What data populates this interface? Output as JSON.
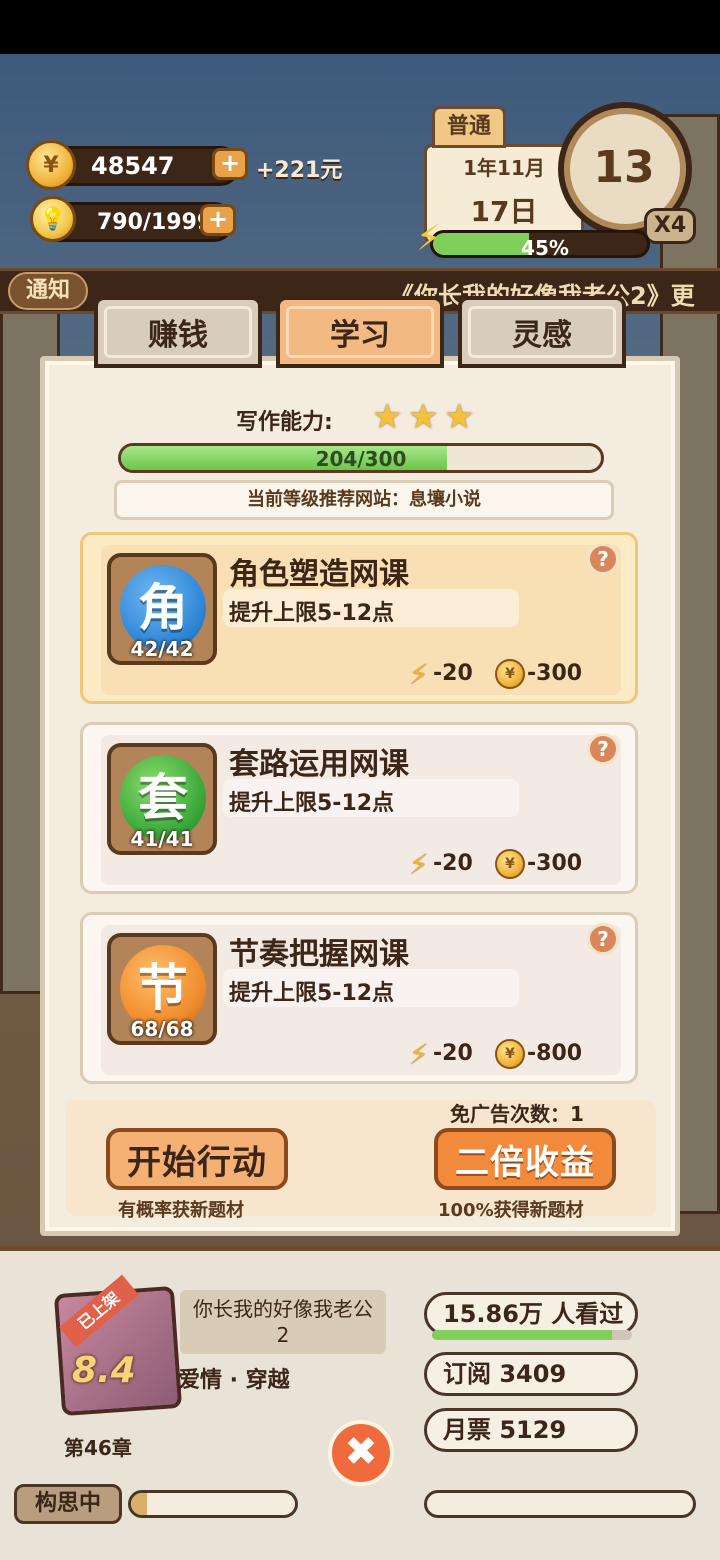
{
  "hud": {
    "coins": "48547",
    "coin_income": "+221元",
    "inspiration": "790/1999",
    "plus_label": "+",
    "mode": "普通",
    "month": "1年11月",
    "day": "17日",
    "clock_value": "13",
    "speed": "X4",
    "energy_percent_text": "45%",
    "energy_level": 0.45
  },
  "notice": {
    "tag": "通知",
    "text": "《你长我的好像我老公2》更"
  },
  "tabs": [
    {
      "label": "赚钱",
      "active": false
    },
    {
      "label": "学习",
      "active": true
    },
    {
      "label": "灵感",
      "active": false
    }
  ],
  "study": {
    "ability_label": "写作能力:",
    "stars": 3,
    "progress_text": "204/300",
    "progress_value": 204,
    "progress_max": 300,
    "site_recommendation": "当前等级推荐网站：息壤小说"
  },
  "courses": [
    {
      "icon_char": "角",
      "icon_color": "#2f86d6",
      "count": "42/42",
      "title": "角色塑造网课",
      "desc": "提升上限5-12点",
      "energy_cost": "-20",
      "coin_cost": "-300",
      "selected": true
    },
    {
      "icon_char": "套",
      "icon_color": "#3aa83a",
      "count": "41/41",
      "title": "套路运用网课",
      "desc": "提升上限5-12点",
      "energy_cost": "-20",
      "coin_cost": "-300",
      "selected": false
    },
    {
      "icon_char": "节",
      "icon_color": "#f08a2c",
      "count": "68/68",
      "title": "节奏把握网课",
      "desc": "提升上限5-12点",
      "energy_cost": "-20",
      "coin_cost": "-800",
      "selected": false
    }
  ],
  "actions": {
    "free_ads": "免广告次数：1",
    "start_label": "开始行动",
    "start_sub": "有概率获新题材",
    "double_label": "二倍收益",
    "double_sub": "100%获得新题材"
  },
  "book": {
    "shelf_tag": "已上架",
    "score": "8.4",
    "title": "你长我的好像我老公2",
    "genre": "爱情 · 穿越",
    "chapter": "第46章",
    "views": "15.86万 人看过",
    "views_level": 0.9,
    "subs": "订阅 3409",
    "monthly": "月票 5129"
  },
  "bottom": {
    "thinking": "构思中",
    "thinking_level": 0.1,
    "close_symbol": "✖"
  },
  "colors": {
    "accent": "#f28a3c",
    "panel_bg": "#f3ecdf",
    "dark_brown": "#3b2618",
    "energy_green": "#7fcf5a"
  }
}
